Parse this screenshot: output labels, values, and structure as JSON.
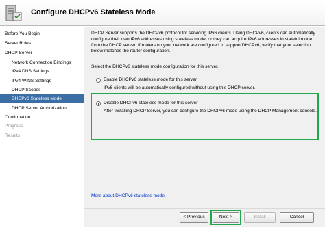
{
  "header": {
    "title": "Configure DHCPv6 Stateless Mode",
    "icon": "server-icon"
  },
  "sidebar": {
    "items": [
      {
        "label": "Before You Begin",
        "level": 1,
        "state": "normal"
      },
      {
        "label": "Server Roles",
        "level": 1,
        "state": "normal"
      },
      {
        "label": "DHCP Server",
        "level": 1,
        "state": "normal"
      },
      {
        "label": "Network Connection Bindings",
        "level": 2,
        "state": "normal"
      },
      {
        "label": "IPv4 DNS Settings",
        "level": 2,
        "state": "normal"
      },
      {
        "label": "IPv4 WINS Settings",
        "level": 2,
        "state": "normal"
      },
      {
        "label": "DHCP Scopes",
        "level": 2,
        "state": "normal"
      },
      {
        "label": "DHCPv6 Stateless Mode",
        "level": 2,
        "state": "active"
      },
      {
        "label": "DHCP Server Authorization",
        "level": 2,
        "state": "normal"
      },
      {
        "label": "Confirmation",
        "level": 1,
        "state": "normal"
      },
      {
        "label": "Progress",
        "level": 1,
        "state": "dim"
      },
      {
        "label": "Results",
        "level": 1,
        "state": "dim"
      }
    ]
  },
  "main": {
    "intro": "DHCP Server supports the DHCPv6 protocol for servicing IPv6 clients. Using DHCPv6, clients can automatically configure their own IPv6 addresses using stateless mode, or they can acquire IPv6 addresses in stateful mode from the DHCP server. If routers on your network are configured to support DHCPv6, verify that your selection below matches the router configuration.",
    "prompt": "Select the DHCPv6 stateless mode configuration for this server.",
    "options": [
      {
        "label": "Enable DHCPv6 stateless mode for this server",
        "description": "IPv6 clients will be automatically configured without using this DHCP server.",
        "selected": false
      },
      {
        "label": "Disable DHCPv6 stateless mode for this server",
        "description": "After installing DHCP Server, you can configure the DHCPv6 mode using the DHCP Management console.",
        "selected": true
      }
    ],
    "more_link": "More about DHCPv6 stateless mode"
  },
  "footer": {
    "previous_label": "< Previous",
    "next_label": "Next >",
    "install_label": "Install",
    "cancel_label": "Cancel",
    "install_enabled": false
  },
  "colors": {
    "highlight": "#22a84a",
    "selection": "#3a6ea5",
    "link": "#0033cc"
  }
}
